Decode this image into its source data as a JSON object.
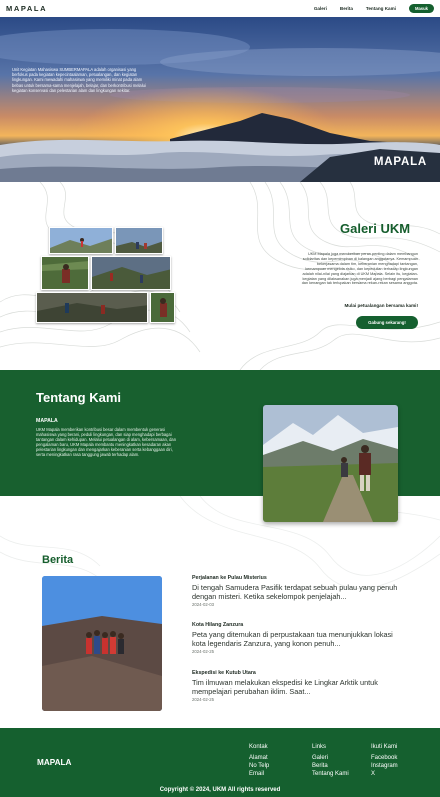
{
  "nav": {
    "brand": "MAPALA",
    "links": [
      "Galeri",
      "Berita",
      "Tentang Kami"
    ],
    "cta": "Masuk"
  },
  "hero": {
    "text": "Unit Kegiatan Mahasiswa SUMBERMAPALA adalah organisasi yang berfokus pada kegiatan kepecintaalaman, petualangan, dan kegiatan lingkungan. Kami mewadahi mahasiswa yang memiliki minat pada alam bebas untuk bersama-sama menjelajah, belajar, dan berkontribusi melalui kegiatan konservasi dan pelestarian alam dan lingkungan sekitar.",
    "title": "MAPALA"
  },
  "gallery": {
    "title": "Galeri UKM",
    "description": "UKM Mapala juga memberikan peran penting dalam membangun solidaritas dan kepemimpinan di kalangan anggotanya. Kemampuan bekerjasama dalam tim, keberanian menghadapi tantangan, kemampuan mengelola risiko, dan kepedulian terhadap lingkungan adalah nilai-nilai yang diajarkan di UKM Mapala. Selain itu, kegiatan-kegiatan yang dilaksanakan juga menjadi ajang berbagi pengalaman dan kenangan tak terlupakan bersama rekan-rekan sesama anggota.",
    "join_text": "Mulai petualangan bersama kami!",
    "button": "Gabung sekarang!"
  },
  "about": {
    "title": "Tentang Kami",
    "subtitle": "MAPALA",
    "text": "UKM Mapala memberikan kontribusi besar dalam membentuk generasi mahasiswa yang berani, peduli lingkungan, dan siap menghadapi berbagai tantangan dalam kehidupan. Melalui petualangan di alam, kebersamaan, dan pengalaman baru, UKM Mapala membantu meningkatkan kesadaran akan pelestarian lingkungan dan mengajarkan keberanian serta kebanggaan diri, serta meningkatkan rasa tanggung jawab terhadap alam."
  },
  "news": {
    "title": "Berita",
    "items": [
      {
        "title": "Perjalanan ke Pulau Misterius",
        "summary": "Di tengah Samudera Pasifik terdapat sebuah pulau yang penuh dengan misteri. Ketika sekelompok penjelajah...",
        "date": "2024-02-03"
      },
      {
        "title": "Kota Hilang Zanzura",
        "summary": "Peta yang ditemukan di perpustakaan tua menunjukkan lokasi kota legendaris Zanzura, yang konon penuh...",
        "date": "2024-02-25"
      },
      {
        "title": "Ekspedisi ke Kutub Utara",
        "summary": "Tim ilmuwan melakukan ekspedisi ke Lingkar Arktik untuk mempelajari perubahan iklim. Saat...",
        "date": "2024-02-25"
      }
    ]
  },
  "footer": {
    "brand": "MAPALA",
    "columns": [
      {
        "heading": "Kontak",
        "items": [
          "Alamat",
          "No Telp",
          "Email"
        ]
      },
      {
        "heading": "Links",
        "items": [
          "Galeri",
          "Berita",
          "Tentang Kami"
        ]
      },
      {
        "heading": "Ikuti Kami",
        "items": [
          "Facebook",
          "Instagram",
          "X"
        ]
      }
    ],
    "copyright": "Copyright © 2024, UKM All rights reserved"
  }
}
